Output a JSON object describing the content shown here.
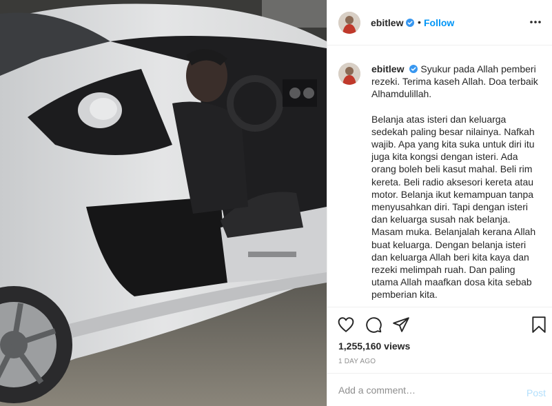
{
  "post": {
    "username": "ebitlew",
    "follow_label": "Follow",
    "caption_line1": "Syukur pada Allah pemberi rezeki. Terima kaseh Allah. Doa terbaik Alhamdulillah.",
    "caption_line2": "Belanja atas isteri dan keluarga sedekah paling besar nilainya. Nafkah wajib. Apa yang kita suka untuk diri itu juga kita kongsi dengan isteri. Ada orang boleh beli kasut mahal. Beli rim kereta. Beli radio aksesori kereta atau motor. Belanja ikut kemampuan tanpa menyusahkan diri. Tapi dengan isteri dan keluarga susah nak belanja. Masam muka. Belanjalah kerana Allah buat keluarga. Dengan belanja isteri dan keluarga Allah beri kita kaya dan rezeki melimpah ruah. Dan paling utama Allah maafkan dosa kita sebab pemberian kita.",
    "views": "1,255,160 views",
    "time": "1 DAY AGO"
  },
  "comment": {
    "placeholder": "Add a comment…",
    "post_label": "Post"
  },
  "colors": {
    "accent": "#0095f6",
    "verified": "#3897f0",
    "post_disabled": "#b2dffc",
    "muted": "#8e8e8e"
  },
  "icons": [
    "verified-badge-icon",
    "more-options-icon",
    "heart-icon",
    "comment-icon",
    "share-icon",
    "bookmark-icon"
  ]
}
